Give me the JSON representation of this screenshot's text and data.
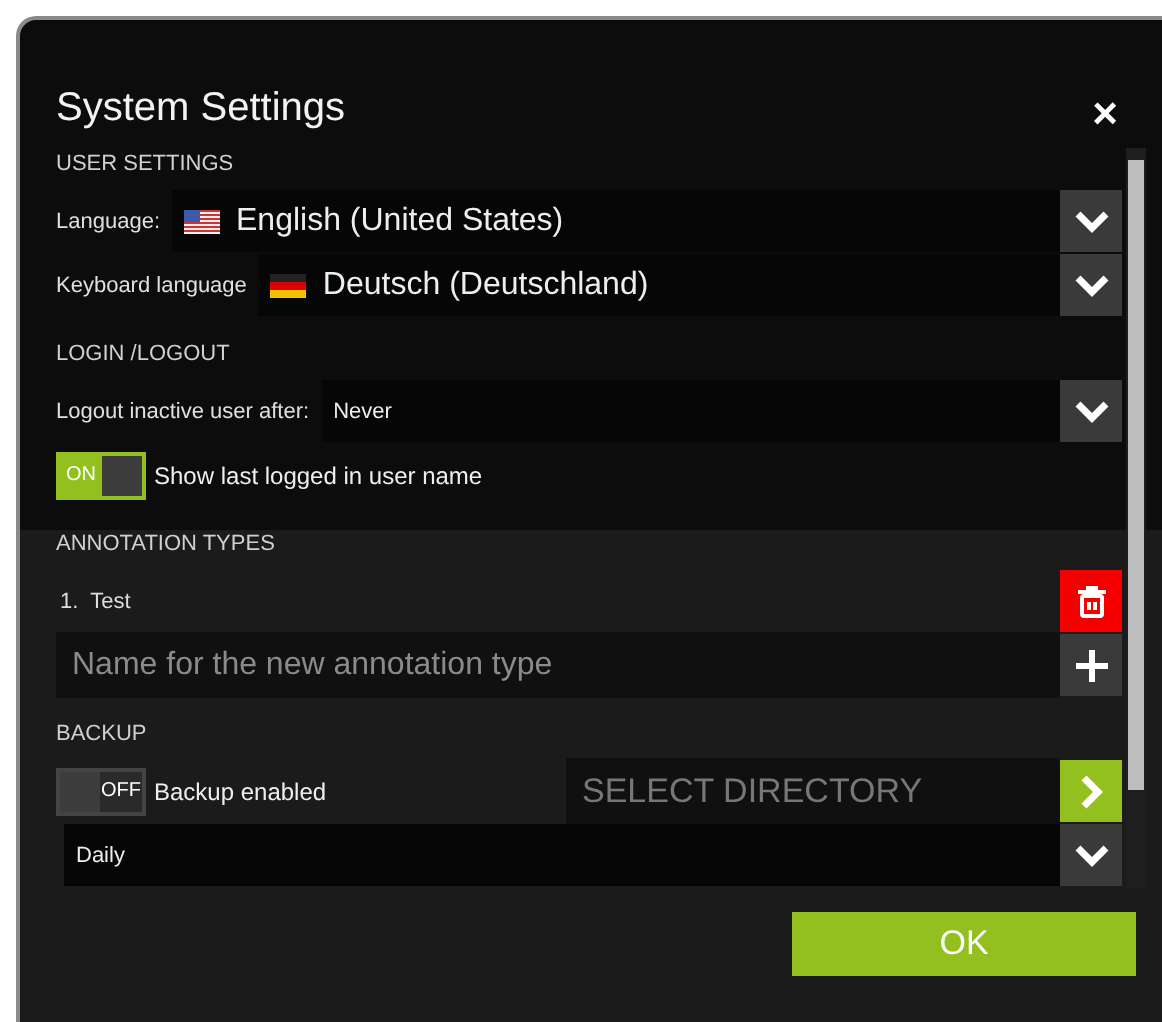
{
  "dialog": {
    "title": "System Settings",
    "close": "×"
  },
  "sections": [
    {
      "heading": "USER SETTINGS",
      "rows": [
        {
          "kind": "language-select",
          "label": "Language:",
          "flag": {
            "kind": "us"
          },
          "value": "English (United States)"
        },
        {
          "kind": "language-select",
          "label": "Keyboard language",
          "flag": {
            "kind": "de"
          },
          "value": "Deutsch (Deutschland)"
        }
      ]
    },
    {
      "heading": "LOGIN /LOGOUT",
      "rows": [
        {
          "kind": "select",
          "label": "Logout inactive user after:",
          "value": "Never"
        },
        {
          "kind": "toggle",
          "on": true,
          "switch_text": "ON",
          "label": "Show last logged in user name"
        }
      ]
    },
    {
      "heading": "ANNOTATION TYPES",
      "rows": [
        {
          "kind": "list-item",
          "number": "1.",
          "text": "Test"
        },
        {
          "kind": "add-input",
          "placeholder": "Name for the new annotation type"
        }
      ]
    },
    {
      "heading": "BACKUP",
      "rows": [
        {
          "kind": "toggle-directory",
          "on": false,
          "switch_text": "OFF",
          "label": "Backup enabled",
          "placeholder": "SELECT DIRECTORY"
        },
        {
          "kind": "select",
          "value": "Daily"
        }
      ]
    }
  ],
  "ok_button": "OK"
}
